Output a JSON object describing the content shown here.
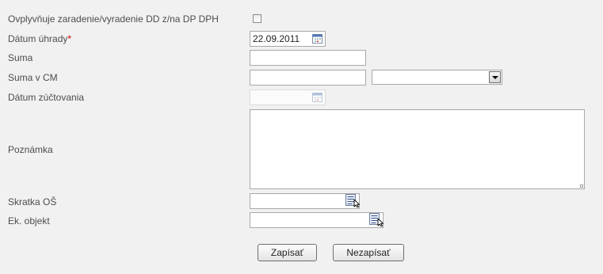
{
  "fields": {
    "vat_label": "Ovplyvňuje zaradenie/vyradenie DD z/na DP DPH",
    "vat_checked": false,
    "payment_date_label": "Dátum úhrady",
    "payment_date_required_mark": "*",
    "payment_date_value": "22.09.2011",
    "amount_label": "Suma",
    "amount_value": "",
    "amount_foreign_label": "Suma v CM",
    "amount_foreign_value": "",
    "currency_selected": "",
    "settlement_date_label": "Dátum zúčtovania",
    "settlement_date_value": "",
    "note_label": "Poznámka",
    "note_value": "",
    "org_unit_label": "Skratka OŠ",
    "org_unit_value": "",
    "econ_object_label": "Ek. objekt",
    "econ_object_value": ""
  },
  "buttons": {
    "save_label": "Zapísať",
    "cancel_label": "Nezapísať"
  },
  "icons": {
    "date_picker": "calendar-icon",
    "lookup": "lookup-list-icon",
    "dropdown": "chevron-down-icon"
  },
  "colors": {
    "background": "#f1f1f1",
    "label_text": "#4d4d4d",
    "required_mark": "#cc0000",
    "input_border": "#a8a8a8"
  }
}
